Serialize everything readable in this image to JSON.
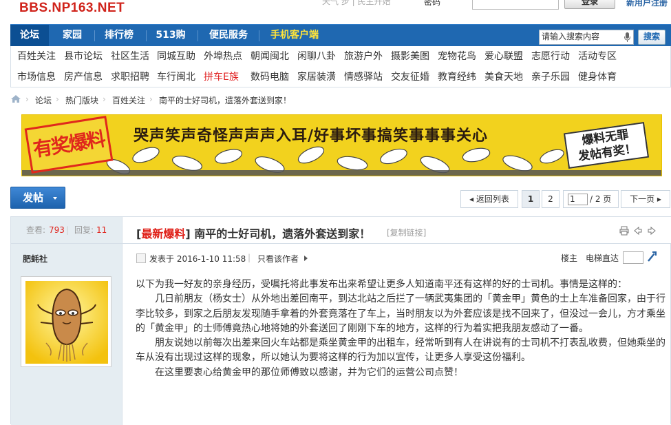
{
  "site": {
    "logo": "BBS.NP163.NET",
    "top_faint": "天气   步 | 民主开始",
    "password_label": "密码",
    "login_btn": "登录",
    "register_link": "新用户注册"
  },
  "nav": {
    "items": [
      "论坛",
      "家园",
      "排行榜",
      "513购",
      "便民服务",
      "手机客户端"
    ],
    "search_placeholder": "请输入搜索内容",
    "search_btn": "搜索"
  },
  "subnav": {
    "row1": [
      "百姓关注",
      "县市论坛",
      "社区生活",
      "同城互助",
      "外埠热点",
      "朝闻闽北",
      "闲聊八卦",
      "旅游户外",
      "摄影美图",
      "宠物花鸟",
      "爱心联盟",
      "志愿行动",
      "活动专区"
    ],
    "row2": [
      "市场信息",
      "房产信息",
      "求职招聘",
      "车行闽北",
      "拼车E族",
      "数码电脑",
      "家居装潢",
      "情感驿站",
      "交友征婚",
      "教育经纬",
      "美食天地",
      "亲子乐园",
      "健身体育"
    ]
  },
  "breadcrumb": [
    "论坛",
    "热门版块",
    "百姓关注",
    "南平的士好司机，遗落外套送到家！"
  ],
  "banner": {
    "stamp": "有奖爆料",
    "slogan": "哭声笑声奇怪声声声入耳/好事坏事搞笑事事事关心",
    "award_l1": "爆料无罪",
    "award_l2": "发帖有奖！"
  },
  "toolbar": {
    "post_btn": "发帖",
    "back_list": "返回列表",
    "page1": "1",
    "page2": "2",
    "page_input": "1",
    "page_total": "/ 2 页",
    "next_page": "下一页"
  },
  "thread": {
    "views_label": "查看:",
    "views": "793",
    "replies_label": "回复:",
    "replies": "11",
    "author": "肥蚝社",
    "title_tag": "最新爆料",
    "title": "南平的士好司机，遗落外套送到家！",
    "copy_link": "[复制链接]",
    "date": "发表于 2016-1-10 11:58",
    "author_only": "只看该作者",
    "floor": "楼主",
    "jump_label": "电梯直达",
    "body": [
      "以下为我一好友的亲身经历，受嘱托将此事发布出来希望让更多人知道南平还有这样的好的士司机。事情是这样的：",
      "　　几日前朋友（杨女士）从外地出差回南平，到达北站之后拦了一辆武夷集团的「黄金甲」黄色的士上车准备回家，由于行李比较多，到家之后朋友发现随手拿着的外套竟落在了车上，当时朋友以为外套应该是找不回来了，但没过一会儿，方才乘坐的「黄金甲」的士师傅竟热心地将她的外套送回了刚刚下车的地方，这样的行为着实把我朋友感动了一番。",
      "　　朋友说她以前每次出差来回火车站都是乘坐黄金甲的出租车，经常听到有人在讲说有的士司机不打表乱收费，但她乘坐的车从没有出现过这样的现象，所以她认为要将这样的行为加以宣传，让更多人享受这份福利。",
      "　　在这里要衷心给黄金甲的那位师傅致以感谢，并为它们的运营公司点赞！"
    ]
  },
  "colors": {
    "brand_blue": "#1f68b1",
    "accent_red": "#e0231b",
    "banner_yellow": "#f2d21e"
  }
}
